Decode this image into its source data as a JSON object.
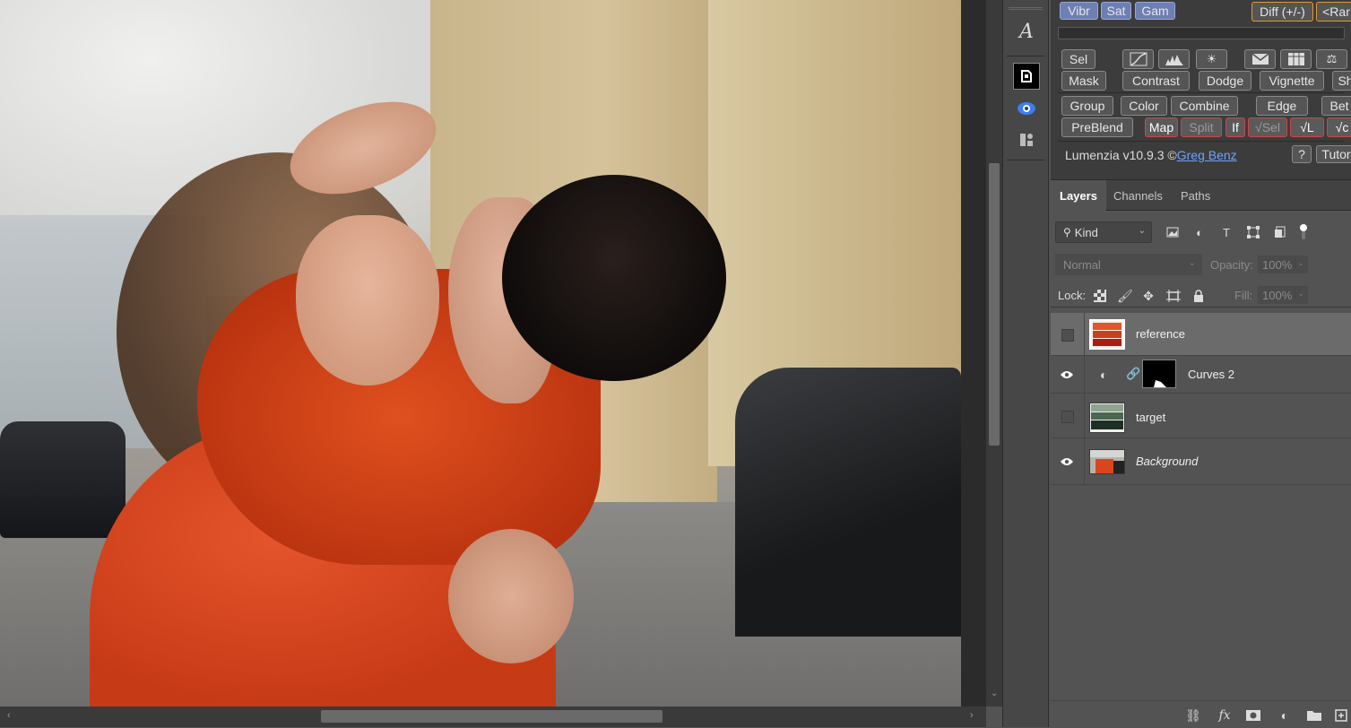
{
  "canvas": {
    "photo_alt": "Photo of two women embracing on a street"
  },
  "lumenzia": {
    "row1": {
      "vibr": "Vibr",
      "sat": "Sat",
      "gam": "Gam",
      "diff": "Diff (+/-)",
      "range": "<Rar"
    },
    "row2": {
      "sel": "Sel"
    },
    "row3": {
      "mask": "Mask",
      "contrast": "Contrast",
      "dodge": "Dodge",
      "vignette": "Vignette",
      "sh": "Sh"
    },
    "row4": {
      "group": "Group",
      "color": "Color",
      "combine": "Combine",
      "edge": "Edge",
      "bet": "Bet"
    },
    "row5": {
      "preblend": "PreBlend",
      "map": "Map",
      "split": "Split",
      "if": "If",
      "vsel": "√Sel",
      "vl": "√L",
      "vc": "√c"
    },
    "footer": {
      "version": "Lumenzia v10.9.3 ©",
      "author": "Greg Benz",
      "help": "?",
      "tutorials": "Tutor"
    }
  },
  "layers_panel": {
    "tabs": [
      "Layers",
      "Channels",
      "Paths"
    ],
    "filter": {
      "kind": "Kind"
    },
    "blend_mode": "Normal",
    "opacity_label": "Opacity:",
    "opacity_value": "100%",
    "lock_label": "Lock:",
    "fill_label": "Fill:",
    "fill_value": "100%",
    "layers": [
      {
        "name": "reference",
        "visible": false,
        "selected": true
      },
      {
        "name": "Curves 2",
        "visible": true,
        "selected": false
      },
      {
        "name": "target",
        "visible": false,
        "selected": false
      },
      {
        "name": "Background",
        "visible": true,
        "selected": false
      }
    ]
  },
  "colors": {
    "accent_blue": "#6d7fb3",
    "red_border": "#d04444",
    "link": "#6aa4ff"
  }
}
